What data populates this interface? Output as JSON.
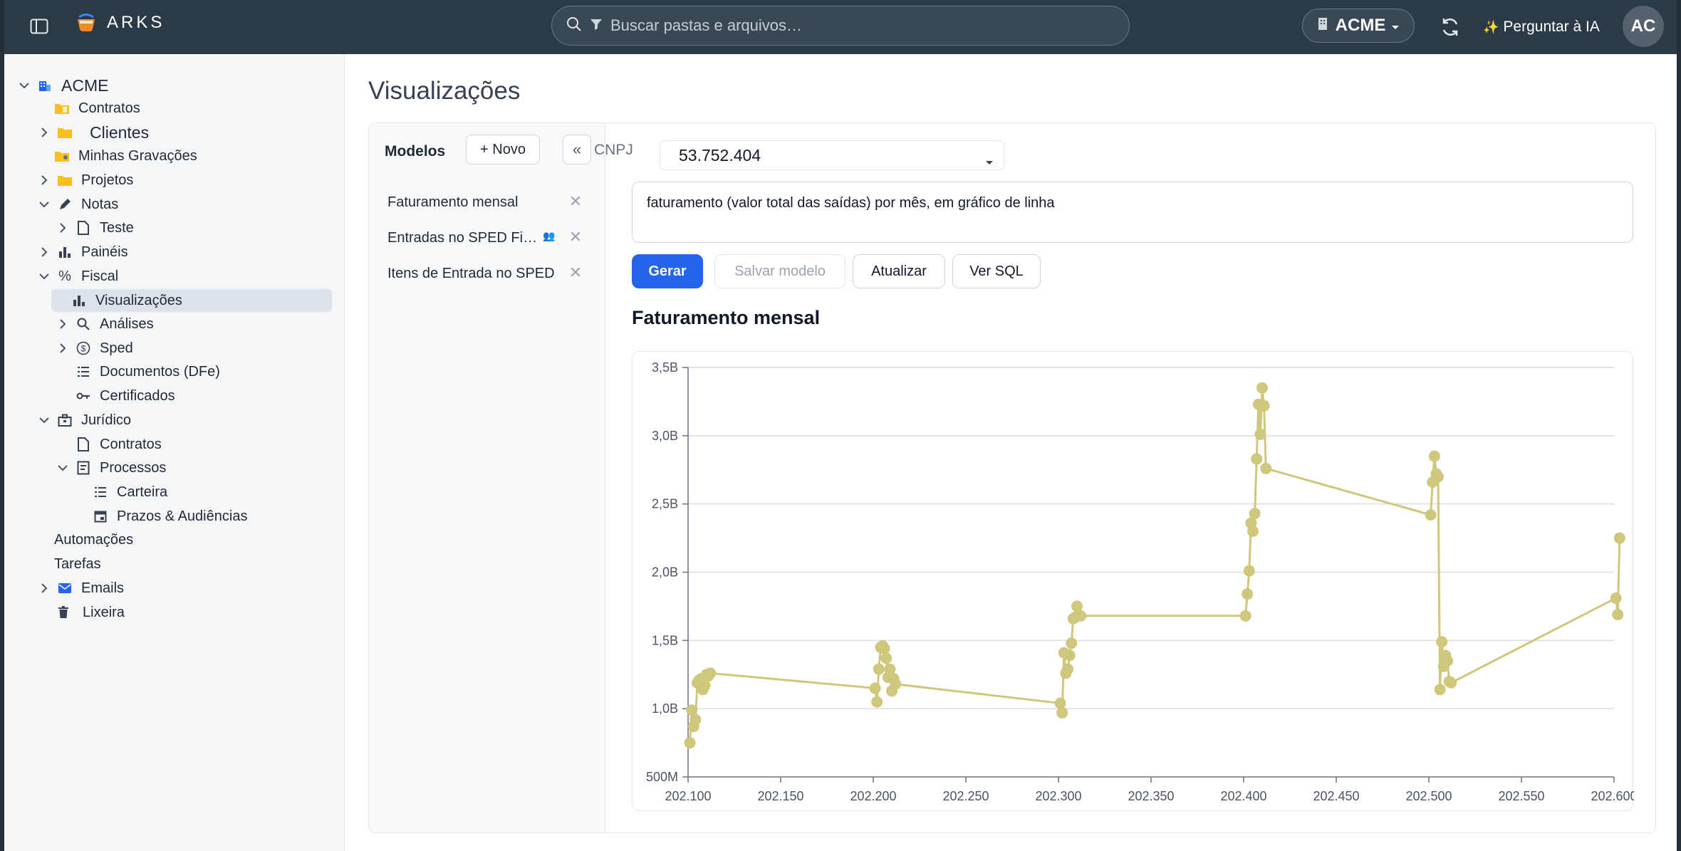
{
  "app": {
    "name": "ARKS"
  },
  "topbar": {
    "search_placeholder": "Buscar pastas e arquivos…",
    "tenant": "ACME",
    "ask_ai": "Perguntar à IA",
    "avatar": "AC"
  },
  "sidebar": {
    "root": "ACME",
    "items": [
      {
        "label": "Contratos"
      },
      {
        "label": "Clientes"
      },
      {
        "label": "Minhas Gravações"
      },
      {
        "label": "Projetos"
      },
      {
        "label": "Notas"
      },
      {
        "label": "Teste"
      },
      {
        "label": "Painéis"
      },
      {
        "label": "Fiscal"
      },
      {
        "label": "Visualizações"
      },
      {
        "label": "Análises"
      },
      {
        "label": "Sped"
      },
      {
        "label": "Documentos (DFe)"
      },
      {
        "label": "Certificados"
      },
      {
        "label": "Jurídico"
      },
      {
        "label": "Contratos"
      },
      {
        "label": "Processos"
      },
      {
        "label": "Carteira"
      },
      {
        "label": "Prazos & Audiências"
      },
      {
        "label": "Automações"
      },
      {
        "label": "Tarefas"
      },
      {
        "label": "Emails"
      },
      {
        "label": "Lixeira"
      }
    ]
  },
  "main": {
    "title": "Visualizações",
    "models": {
      "title": "Modelos",
      "new_label": "+ Novo",
      "collapse_label": "«",
      "items": [
        {
          "label": "Faturamento mensal"
        },
        {
          "label": "Entradas no SPED Fiscal"
        },
        {
          "label": "Itens de Entrada no SPED"
        }
      ]
    },
    "cnpj_label": "CNPJ",
    "cnpj_value": "53.752.404",
    "prompt": "faturamento (valor total das saídas) por mês, em gráfico de linha",
    "buttons": {
      "generate": "Gerar",
      "save_model": "Salvar modelo",
      "refresh": "Atualizar",
      "view_sql": "Ver SQL"
    },
    "chart_title": "Faturamento mensal"
  },
  "colors": {
    "accent": "#2563eb",
    "series": "#cfc77c",
    "topbar": "#2c3a48"
  },
  "chart_data": {
    "type": "line",
    "title": "Faturamento mensal",
    "xlim": [
      202100,
      202600
    ],
    "ylim": [
      500000000,
      3500000000
    ],
    "x_ticks": [
      "202.100",
      "202.150",
      "202.200",
      "202.250",
      "202.300",
      "202.350",
      "202.400",
      "202.450",
      "202.500",
      "202.550",
      "202.600"
    ],
    "y_ticks": [
      "500M",
      "1,0B",
      "1,5B",
      "2,0B",
      "2,5B",
      "3,0B",
      "3,5B"
    ],
    "grid": "horizontal",
    "series": [
      {
        "x": [
          202101,
          202102,
          202103,
          202104,
          202105,
          202106,
          202107,
          202108,
          202109,
          202110,
          202111,
          202112,
          202201,
          202202,
          202203,
          202204,
          202205,
          202206,
          202207,
          202208,
          202209,
          202210,
          202211,
          202212,
          202301,
          202302,
          202303,
          202304,
          202305,
          202306,
          202307,
          202308,
          202309,
          202310,
          202311,
          202312,
          202401,
          202402,
          202403,
          202404,
          202405,
          202406,
          202407,
          202408,
          202409,
          202410,
          202411,
          202412,
          202501,
          202502,
          202503,
          202504,
          202505,
          202506,
          202507,
          202508,
          202509,
          202510,
          202511,
          202512,
          202601,
          202602,
          202603
        ],
        "y": [
          750000000,
          990000000,
          870000000,
          920000000,
          1190000000,
          1210000000,
          1220000000,
          1140000000,
          1170000000,
          1250000000,
          1240000000,
          1260000000,
          1150000000,
          1050000000,
          1290000000,
          1450000000,
          1460000000,
          1440000000,
          1370000000,
          1230000000,
          1290000000,
          1130000000,
          1220000000,
          1180000000,
          1040000000,
          970000000,
          1410000000,
          1260000000,
          1290000000,
          1390000000,
          1480000000,
          1660000000,
          1670000000,
          1750000000,
          1680000000,
          1680000000,
          1680000000,
          1840000000,
          2010000000,
          2360000000,
          2300000000,
          2430000000,
          2830000000,
          3230000000,
          3010000000,
          3350000000,
          3220000000,
          2760000000,
          2420000000,
          2660000000,
          2850000000,
          2720000000,
          2700000000,
          1140000000,
          1490000000,
          1310000000,
          1390000000,
          1350000000,
          1200000000,
          1190000000,
          1810000000,
          1690000000,
          2250000000
        ]
      }
    ]
  }
}
